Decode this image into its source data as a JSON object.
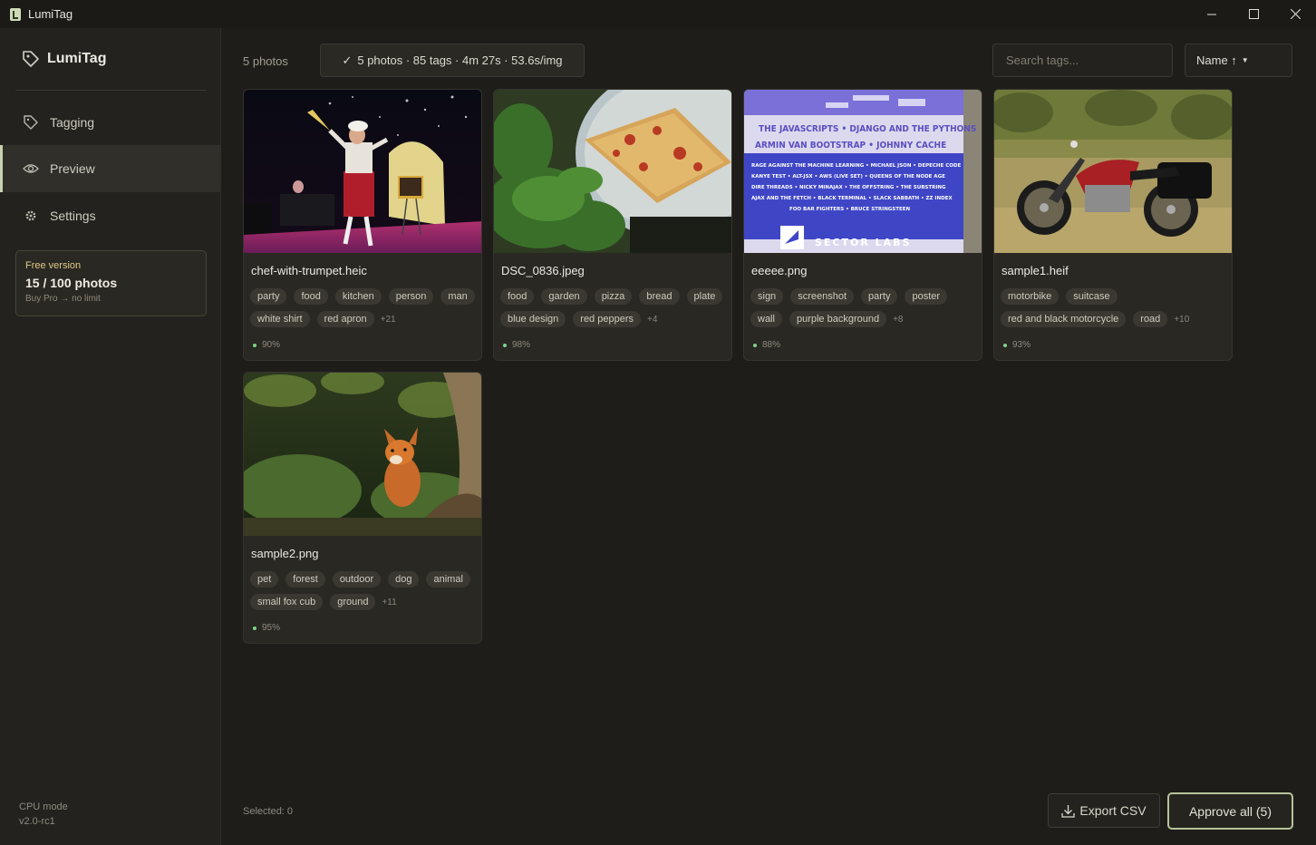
{
  "window": {
    "title": "LumiTag",
    "controls": [
      "minimize",
      "maximize",
      "close"
    ]
  },
  "sidebar": {
    "brand": "LumiTag",
    "nav": [
      {
        "label": "Tagging",
        "icon": "tag-icon",
        "active": false
      },
      {
        "label": "Preview",
        "icon": "eye-icon",
        "active": true
      },
      {
        "label": "Settings",
        "icon": "gear-icon",
        "active": false
      }
    ],
    "license": {
      "label": "Free version",
      "count": "15 / 100 photos",
      "upsell": "Buy Pro → no limit"
    },
    "footer": {
      "mode": "CPU mode",
      "version": "v2.0-rc1"
    }
  },
  "toolbar": {
    "photo_count": "5 photos",
    "status": "5 photos · 85 tags · 4m 27s · 53.6s/img",
    "search_placeholder": "Search tags...",
    "sort_label": "Name ↑"
  },
  "photos": [
    {
      "filename": "chef-with-trumpet.heic",
      "tags": [
        "party",
        "food",
        "kitchen",
        "person",
        "man",
        "white shirt",
        "red apron"
      ],
      "more": "+21",
      "confidence": "90%"
    },
    {
      "filename": "DSC_0836.jpeg",
      "tags": [
        "food",
        "garden",
        "pizza",
        "bread",
        "plate",
        "blue design",
        "red peppers"
      ],
      "more": "+4",
      "confidence": "98%"
    },
    {
      "filename": "eeeee.png",
      "tags": [
        "sign",
        "screenshot",
        "party",
        "poster",
        "wall",
        "purple background"
      ],
      "more": "+8",
      "confidence": "88%"
    },
    {
      "filename": "sample1.heif",
      "tags": [
        "motorbike",
        "suitcase",
        "red and black motorcycle",
        "road"
      ],
      "more": "+10",
      "confidence": "93%"
    },
    {
      "filename": "sample2.png",
      "tags": [
        "pet",
        "forest",
        "outdoor",
        "dog",
        "animal",
        "small fox cub",
        "ground"
      ],
      "more": "+11",
      "confidence": "95%"
    }
  ],
  "poster_text": {
    "line1": "THE JAVASCRIPTS • DJANGO AND THE PYTHONS",
    "line2": "ARMIN VAN BOOTSTRAP • JOHNNY CACHE",
    "line3": "RAGE AGAINST THE MACHINE LEARNING • MICHAEL JSON • DEPECHE CODE",
    "line4": "KANYE TEST • ALT-JSX • AWS (LIVE SET) • QUEENS OF THE NODE AGE",
    "line5": "DIRE THREADS • NICKY MINAJAX • THE OFFSTRING • THE SUBSTRING",
    "line6": "AJAX AND THE FETCH • BLACK TERMINAL • SLACK SABBATH • ZZ INDEX",
    "line7": "FOO BAR FIGHTERS • BRUCE STRINGSTEEN",
    "logo": "SECTOR LABS"
  },
  "footer": {
    "selected": "Selected: 0",
    "export_label": "Export CSV",
    "approve_label": "Approve all (5)"
  },
  "colors": {
    "accent": "#b8c49a",
    "license_label": "#e0c98a",
    "confidence_dot": "#7fd486"
  }
}
